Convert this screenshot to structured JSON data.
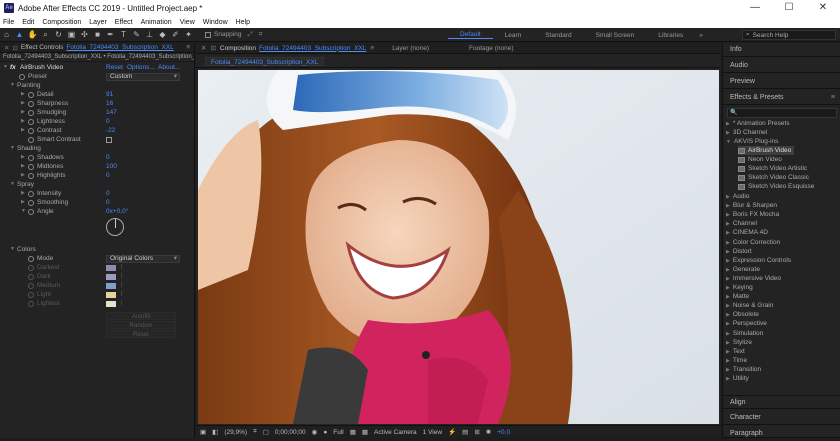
{
  "window": {
    "title": "Adobe After Effects CC 2019 - Untitled Project.aep *",
    "app_icon": "Ae",
    "minimize": "—",
    "maximize": "☐",
    "close": "✕"
  },
  "menu": [
    "File",
    "Edit",
    "Composition",
    "Layer",
    "Effect",
    "Animation",
    "View",
    "Window",
    "Help"
  ],
  "toolbar": {
    "snapping": "Snapping",
    "workspaces": [
      "Default",
      "Learn",
      "Standard",
      "Small Screen",
      "Libraries"
    ],
    "workspace_active": "Default",
    "search_placeholder": "Search Help"
  },
  "effect_controls": {
    "tab_label": "Effect Controls",
    "tab_file": "Fotolia_72494403_Subscription_XXL",
    "breadcrumb": "Fotolia_72494403_Subscription_XXL • Fotolia_72494403_Subscription_X",
    "effect_name": "AirBrush Video",
    "reset": "Reset",
    "options": "Options...",
    "about": "About...",
    "preset_label": "Preset",
    "preset_value": "Custom",
    "painting_label": "Painting",
    "detail_label": "Detail",
    "detail_value": "91",
    "sharpness_label": "Sharpness",
    "sharpness_value": "16",
    "smudging_label": "Smudging",
    "smudging_value": "147",
    "lightness_label": "Lightness",
    "lightness_value": "0",
    "contrast_label": "Contrast",
    "contrast_value": "-22",
    "smart_contrast_label": "Smart Contrast",
    "shading_label": "Shading",
    "shadows_label": "Shadows",
    "shadows_value": "0",
    "midtones_label": "Midtones",
    "midtones_value": "100",
    "highlights_label": "Highlights",
    "highlights_value": "0",
    "spray_label": "Spray",
    "intensity_label": "Intensity",
    "intensity_value": "0",
    "smoothing_label": "Smoothing",
    "smoothing_value": "0",
    "angle_label": "Angle",
    "angle_value": "0x+0,0°",
    "colors_label": "Colors",
    "mode_label": "Mode",
    "mode_value": "Original Colors",
    "darkest_label": "Darkest",
    "darkest_color": "#8f8ab0",
    "dark_label": "Dark",
    "dark_color": "#9a9ac4",
    "medium_label": "Medium",
    "medium_color": "#7f9fce",
    "light_label": "Light",
    "light_color": "#e5d49a",
    "lightest_label": "Lightest",
    "lightest_color": "#e8e0c8",
    "autofill": "Autofill",
    "random": "Random",
    "reset_btn": "Reset"
  },
  "composition": {
    "tab_label": "Composition",
    "tab_file": "Fotolia_72494403_Subscription_XXL",
    "layer_tab": "Layer (none)",
    "footage_tab": "Footage (none)",
    "chip": "Fotolia_72494403_Subscription_XXL",
    "zoom": "(29,9%)",
    "timecode": "0;00;00;00",
    "resolution": "Full",
    "camera": "Active Camera",
    "views": "1 View",
    "exposure": "+0,0"
  },
  "right_panel": {
    "info": "Info",
    "audio": "Audio",
    "preview": "Preview",
    "effects_presets": "Effects & Presets",
    "search_glyph": "🔍",
    "categories_top": [
      "* Animation Presets",
      "3D Channel",
      "AKVIS Plug-ins"
    ],
    "akvis_items": [
      "AirBrush Video",
      "Neon Video",
      "Sketch Video Artistic",
      "Sketch Video Classic",
      "Sketch Video Esquisse"
    ],
    "akvis_selected": "AirBrush Video",
    "categories": [
      "Audio",
      "Blur & Sharpen",
      "Boris FX Mocha",
      "Channel",
      "CINEMA 4D",
      "Color Correction",
      "Distort",
      "Expression Controls",
      "Generate",
      "Immersive Video",
      "Keying",
      "Matte",
      "Noise & Grain",
      "Obsolete",
      "Perspective",
      "Simulation",
      "Stylize",
      "Text",
      "Time",
      "Transition",
      "Utility"
    ],
    "align": "Align",
    "character": "Character",
    "paragraph": "Paragraph"
  },
  "colors": {
    "accent": "#4a8cf7",
    "panel_bg": "#232323",
    "dark_bg": "#1d1d1d"
  }
}
